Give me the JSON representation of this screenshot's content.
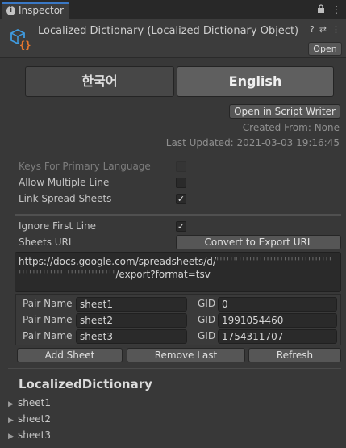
{
  "window": {
    "tab_title": "Inspector",
    "tab_icon": "info-icon",
    "tab_icons": [
      "lock-icon",
      "more-options-icon"
    ]
  },
  "header": {
    "title": "Localized Dictionary (Localized Dictionary Object)",
    "icons": [
      "help-icon",
      "preset-icon",
      "more-options-icon"
    ],
    "open_label": "Open"
  },
  "languages": {
    "korean": "한국어",
    "english": "English",
    "selected": "English"
  },
  "script_writer_label": "Open in Script Writer",
  "created_from": "Created From: None",
  "last_updated": "Last Updated: 2021-03-03 19:16:45",
  "properties": {
    "keys_primary": {
      "label": "Keys For Primary Language",
      "checked": false,
      "disabled": true
    },
    "allow_multiple": {
      "label": "Allow Multiple Line",
      "checked": false
    },
    "link_sheets": {
      "label": "Link Spread Sheets",
      "checked": true,
      "mark": "✓"
    }
  },
  "sheets": {
    "ignore_first": {
      "label": "Ignore First Line",
      "checked": true,
      "mark": "✓"
    },
    "url_label": "Sheets URL",
    "convert_label": "Convert to Export URL",
    "url_line1_start": "https://docs.google.com/spreadsheets/d/",
    "url_line2_end": "/export?format=tsv",
    "pairs": [
      {
        "name_label": "Pair Name",
        "name": "sheet1",
        "gid_label": "GID",
        "gid": "0"
      },
      {
        "name_label": "Pair Name",
        "name": "sheet2",
        "gid_label": "GID",
        "gid": "1991054460"
      },
      {
        "name_label": "Pair Name",
        "name": "sheet3",
        "gid_label": "GID",
        "gid": "1754311707"
      }
    ],
    "add_label": "Add Sheet",
    "remove_label": "Remove Last",
    "refresh_label": "Refresh"
  },
  "dictionary": {
    "title": "LocalizedDictionary",
    "arrow": "▶",
    "items": [
      "sheet1",
      "sheet2",
      "sheet3"
    ]
  }
}
